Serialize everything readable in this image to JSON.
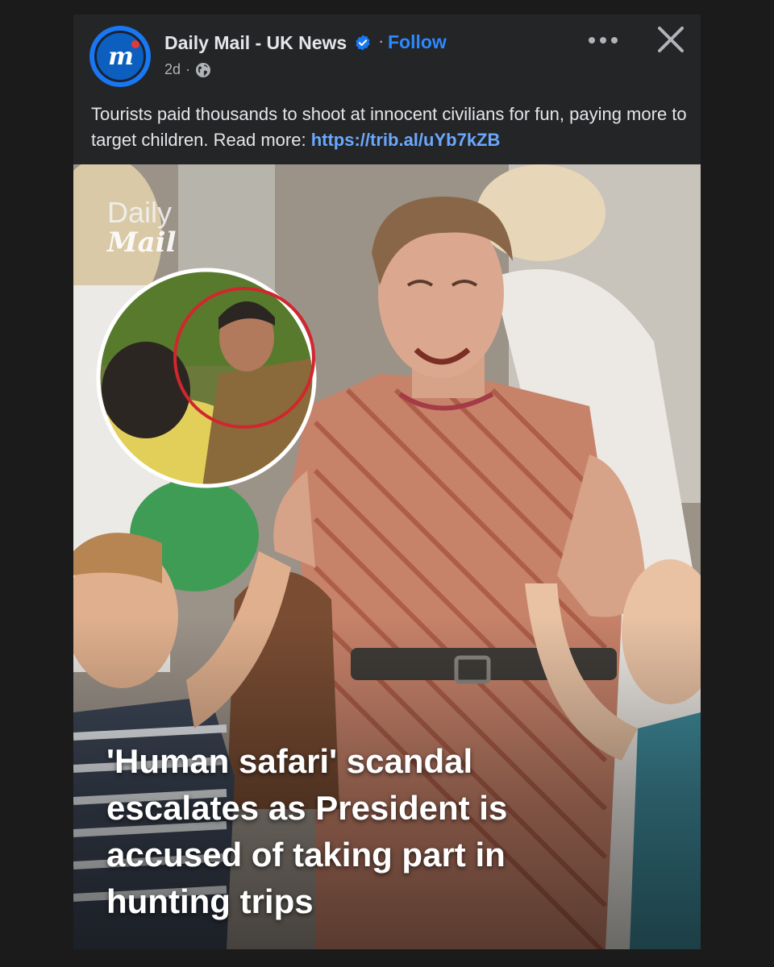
{
  "post": {
    "page_name": "Daily Mail - UK News",
    "follow_label": "Follow",
    "separator": "·",
    "timestamp": "2d",
    "meta_separator": "·",
    "caption_text": "Tourists paid thousands to shoot at innocent civilians for fun, paying more to target children. Read more: ",
    "caption_link": "https://trib.al/uYb7kZB"
  },
  "image": {
    "brand_line1": "Daily",
    "brand_line2": "Mail",
    "headline": "'Human safari' scandal escalates as President is accused of taking part in hunting trips"
  },
  "icons": {
    "avatar": "daily-mail-logo",
    "verified": "verified-badge-icon",
    "audience": "globe-icon",
    "more": "more-options-icon",
    "close": "close-icon"
  },
  "colors": {
    "background": "#1b1b1b",
    "card": "#242526",
    "text": "#e4e6eb",
    "secondary_text": "#b0b3b8",
    "link": "#2d88ff",
    "verified": "#1877f2"
  }
}
